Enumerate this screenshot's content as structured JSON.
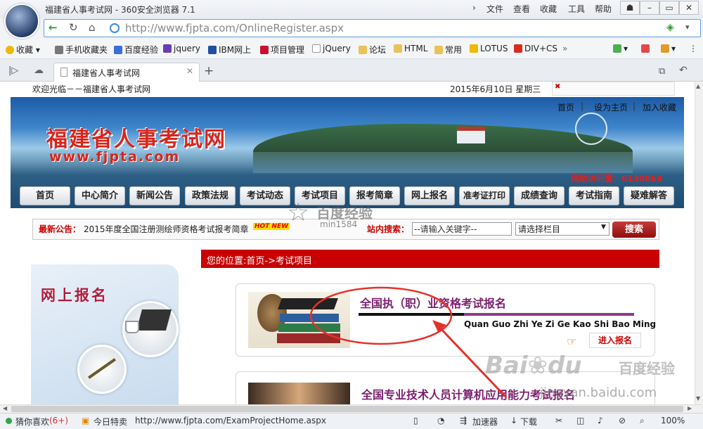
{
  "browser": {
    "window_title": "福建省人事考试网 - 360安全浏览器 7.1",
    "menu": [
      "文件",
      "查看",
      "收藏",
      "工具",
      "帮助"
    ],
    "address": "http://www.fjpta.com/OnlineRegister.aspx",
    "bookmarks": [
      "收藏",
      "手机收藏夹",
      "百度经验",
      "jquery",
      "IBM网上",
      "项目管理",
      "jQuery",
      "论坛",
      "HTML",
      "常用",
      "LOTUS",
      "DIV+CS"
    ],
    "tab_title": "福建省人事考试网"
  },
  "site": {
    "welcome": "欢迎光临－－福建省人事考试网",
    "date": "2015年6月10日 星期三",
    "top_links": [
      "首页",
      "设为主页",
      "加入收藏"
    ],
    "logo_cn": "福建省人事考试网",
    "logo_url": "www.fjpta.com",
    "visits": "网站访问量：6130068",
    "nav": [
      "首页",
      "中心简介",
      "新闻公告",
      "政策法规",
      "考试动态",
      "考试项目",
      "报考简章",
      "网上报名",
      "准考证打印",
      "成绩查询",
      "考试指南",
      "疑难解答"
    ],
    "notice_label": "最新公告：",
    "notice_text": "2015年度全国注册测绘师资格考试报考简章",
    "hot_badge": "HOT NEW",
    "search_label": "站内搜索：",
    "search_placeholder": "--请输入关键字--",
    "search_select": "请选择栏目",
    "search_button": "搜索",
    "breadcrumb": "您的位置:首页->考试项目",
    "side_title": "网上报名",
    "card1_title": "全国执（职）业资格考试报名",
    "card1_pinyin": "Quan Guo Zhi Ye Zi Ge Kao Shi Bao Ming",
    "card1_button": "进入报名",
    "card2_title": "全国专业技术人员计算机应用能力考试报名"
  },
  "watermarks": {
    "baidu_center": "百度经验",
    "baidu_user": "min1584",
    "baidu_corner": "jingyan.baidu.com"
  },
  "statusbar": {
    "guess": "猜你喜欢",
    "guess_count": "(6+)",
    "today": "今日特卖",
    "link": "http://www.fjpta.com/ExamProjectHome.aspx",
    "accelerator": "加速器",
    "download": "下载",
    "zoom": "100%"
  },
  "colors": {
    "accent_red": "#c80000",
    "nav_blue": "#1d5aa6",
    "title_purple": "#7a1f6e",
    "annotation": "#e4312b"
  }
}
